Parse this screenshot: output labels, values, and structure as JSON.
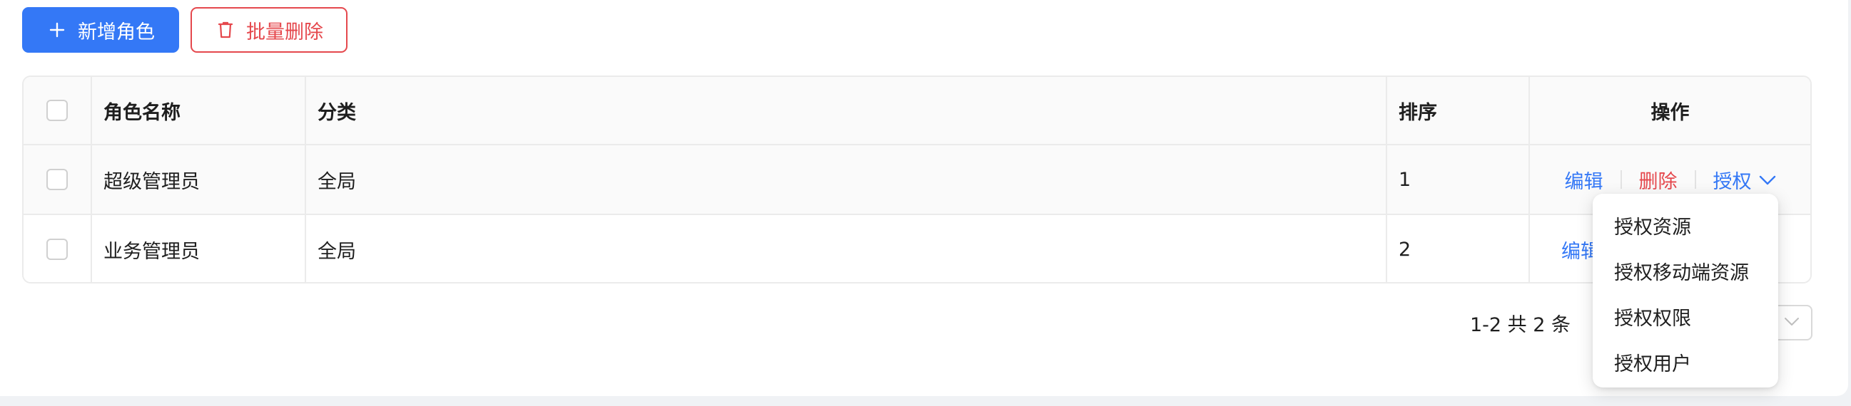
{
  "toolbar": {
    "add_label": "新增角色",
    "batch_delete_label": "批量删除"
  },
  "table": {
    "headers": {
      "name": "角色名称",
      "category": "分类",
      "sort": "排序",
      "actions": "操作"
    },
    "rows": [
      {
        "name": "超级管理员",
        "category": "全局",
        "sort": "1"
      },
      {
        "name": "业务管理员",
        "category": "全局",
        "sort": "2"
      }
    ],
    "actions": {
      "edit": "编辑",
      "delete": "删除",
      "authorize": "授权"
    }
  },
  "pagination": {
    "total_text": "1-2 共 2 条"
  },
  "authorize_menu": {
    "items": [
      "授权资源",
      "授权移动端资源",
      "授权权限",
      "授权用户"
    ]
  },
  "colors": {
    "primary": "#3478f6",
    "danger": "#e5484d"
  },
  "icons": {
    "add": "plus-icon",
    "batch_delete": "trash-icon",
    "authorize_toggle": "chevron-down-icon",
    "page_size_toggle": "chevron-down-icon"
  }
}
